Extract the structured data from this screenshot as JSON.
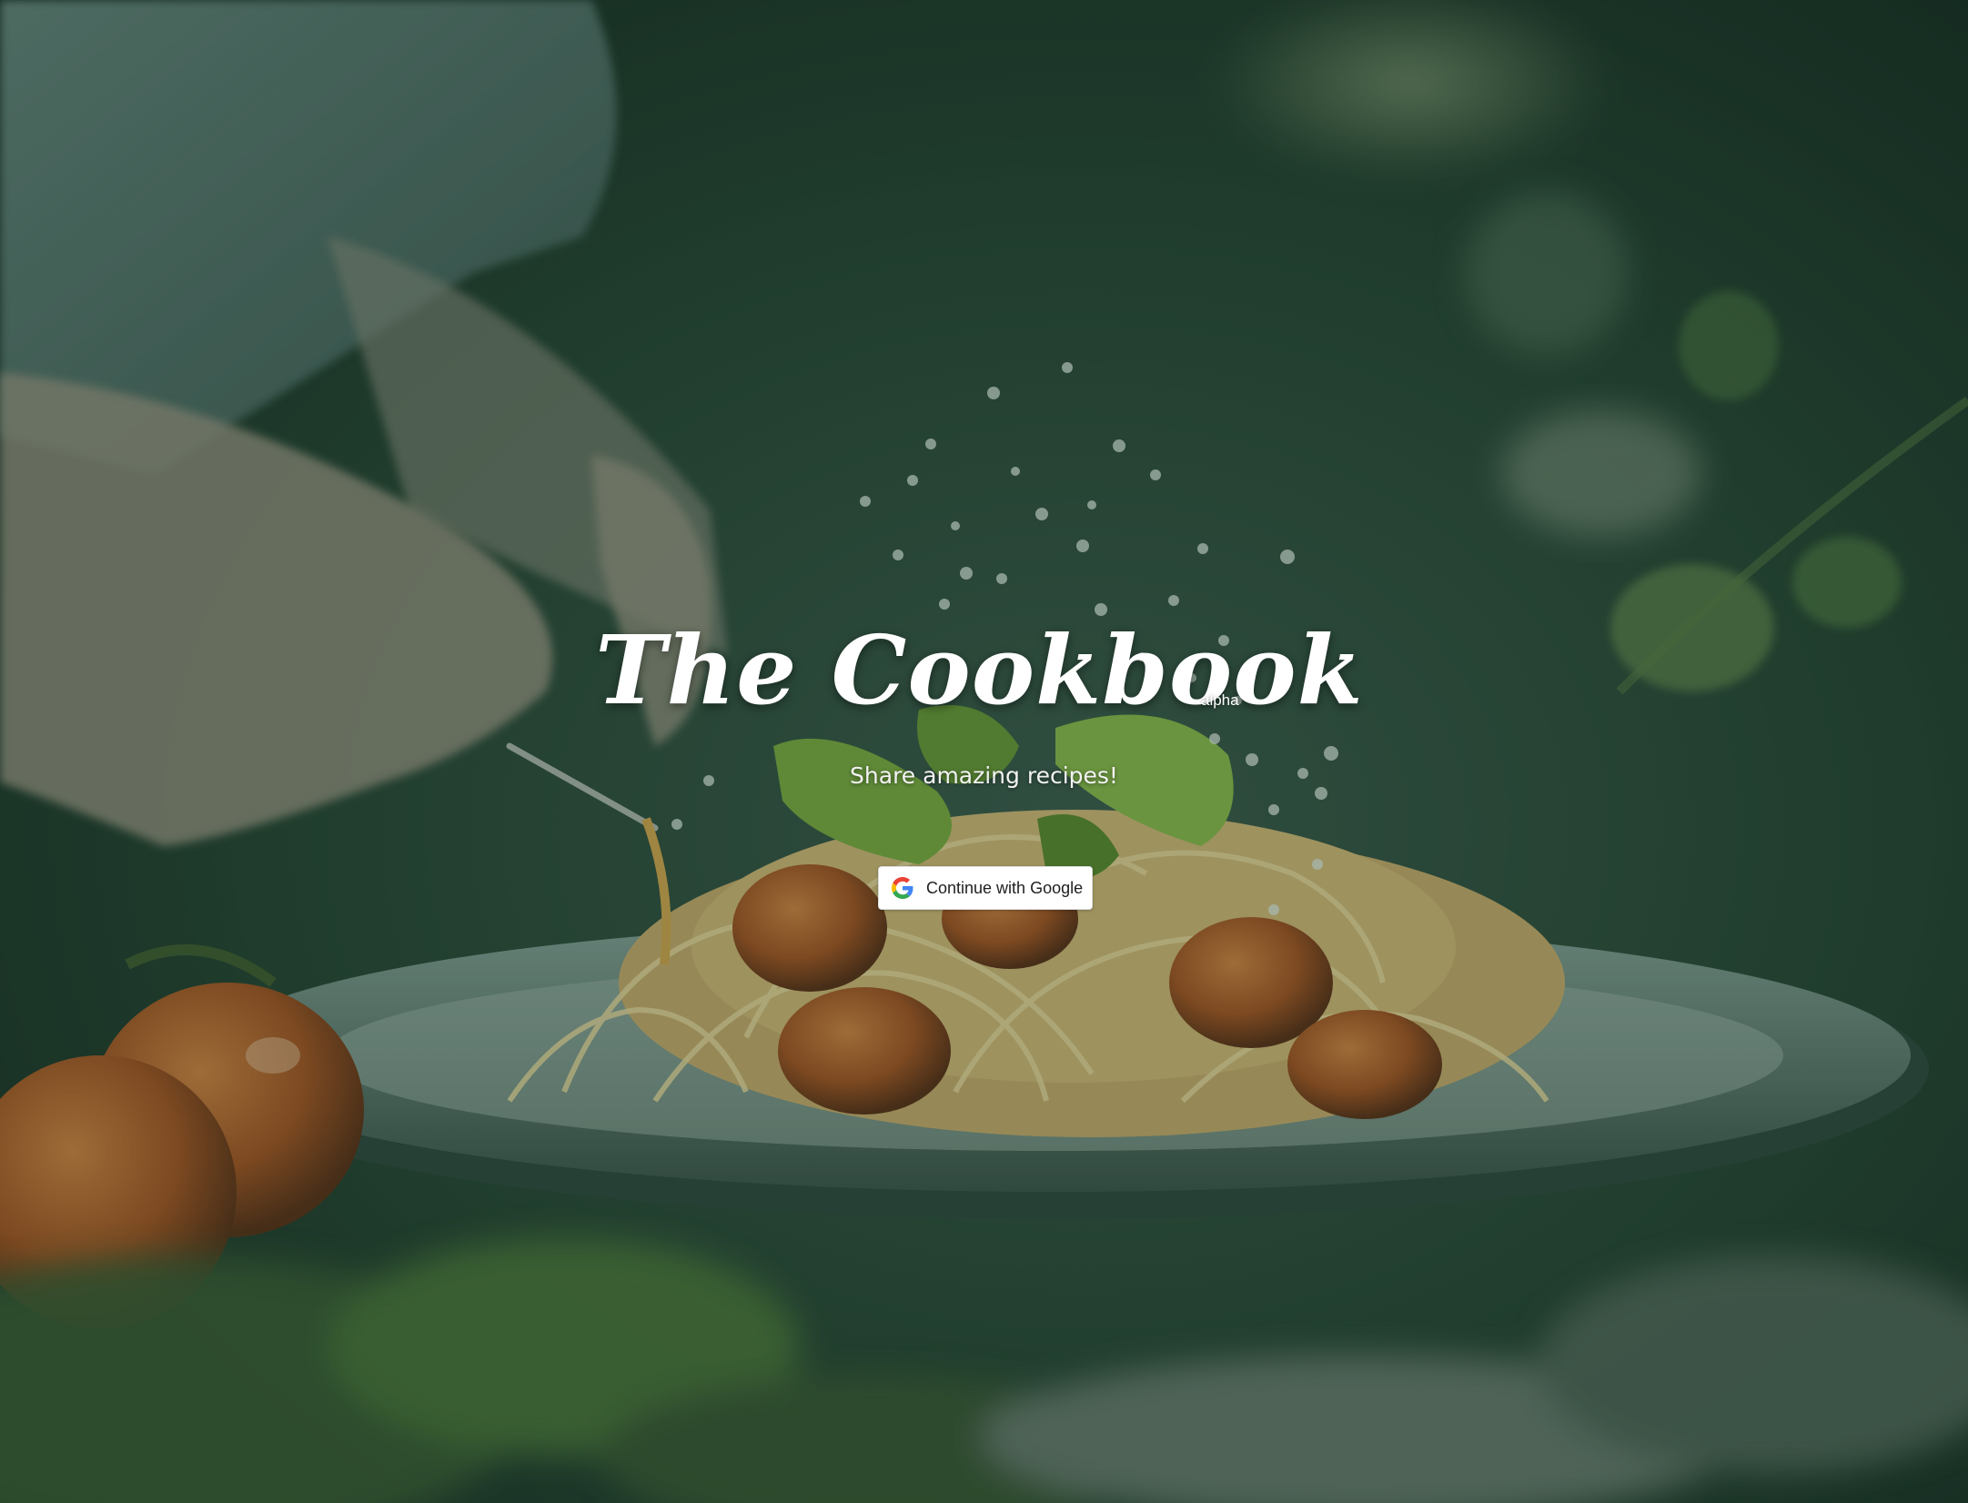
{
  "hero": {
    "title": "The Cookbook",
    "badge": "alpha",
    "tagline": "Share amazing recipes!"
  },
  "auth": {
    "google_button_label": "Continue with Google"
  },
  "background": {
    "description_icon": "pasta-plate-photo",
    "overlay_color": "#1c3a30"
  },
  "icons": {
    "google": "google-g-icon"
  },
  "colors": {
    "google_blue": "#4285F4",
    "google_red": "#EA4335",
    "google_yellow": "#FBBC05",
    "google_green": "#34A853"
  }
}
